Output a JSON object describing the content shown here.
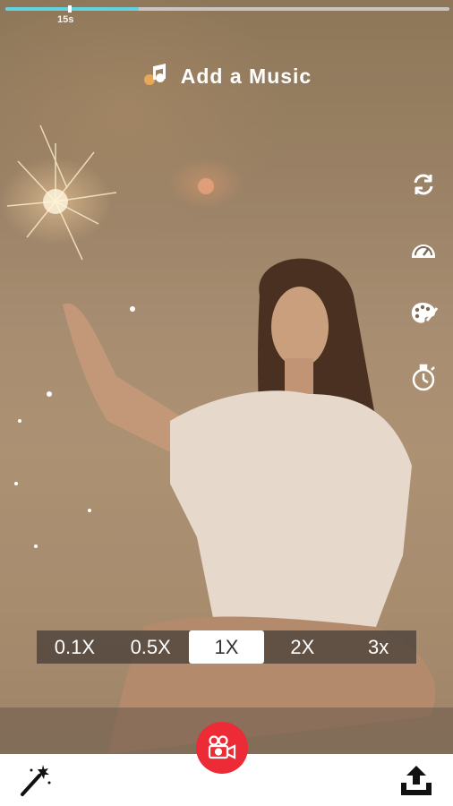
{
  "progress": {
    "duration_label": "15s",
    "fill": 0.3,
    "fill_color": "#5fd3e0"
  },
  "music": {
    "label": "Add a Music",
    "icon": "music-note-icon"
  },
  "side_tools": [
    {
      "name": "switch-camera",
      "icon": "refresh-icon"
    },
    {
      "name": "speed",
      "icon": "speedometer-icon"
    },
    {
      "name": "filters",
      "icon": "palette-icon"
    },
    {
      "name": "timer",
      "icon": "stopwatch-icon"
    }
  ],
  "speed_options": [
    "0.1X",
    "0.5X",
    "1X",
    "2X",
    "3x"
  ],
  "speed_selected": "1X",
  "bottom": {
    "left_icon": "magic-wand-icon",
    "record_icon": "video-camera-icon",
    "right_icon": "upload-icon",
    "record_color": "#ec2b36"
  }
}
